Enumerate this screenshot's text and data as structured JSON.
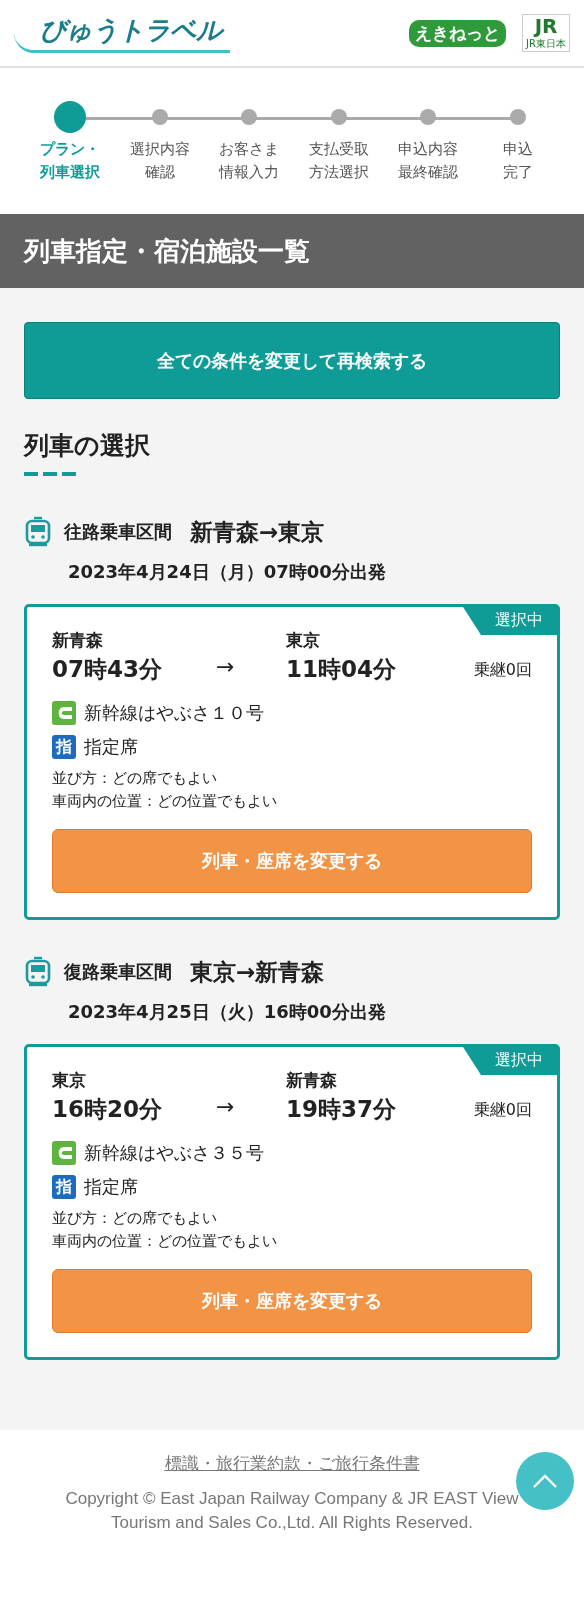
{
  "header": {
    "logo": "びゅうトラベル",
    "partner_logo": "えきねっと",
    "jr_logo": "JR",
    "jr_caption": "JR東日本"
  },
  "steps": [
    {
      "lines": [
        "プラン・",
        "列車選択"
      ],
      "selected": true
    },
    {
      "lines": [
        "選択内容",
        "確認"
      ],
      "selected": false
    },
    {
      "lines": [
        "お客さま",
        "情報入力"
      ],
      "selected": false
    },
    {
      "lines": [
        "支払受取",
        "方法選択"
      ],
      "selected": false
    },
    {
      "lines": [
        "申込内容",
        "最終確認"
      ],
      "selected": false
    },
    {
      "lines": [
        "申込",
        "完了"
      ],
      "selected": false
    }
  ],
  "page_title": "列車指定・宿泊施設一覧",
  "research_button": "全ての条件を変更して再検索する",
  "section_title": "列車の選択",
  "legs": [
    {
      "label": "往路乗車区間",
      "route": "新青森→東京",
      "departure": "2023年4月24日（月）07時00分出発",
      "badge": "選択中",
      "from": "新青森",
      "from_time": "07時43分",
      "arrow": "→",
      "to": "東京",
      "to_time": "11時04分",
      "transfers": "乗継0回",
      "train": "新幹線はやぶさ１０号",
      "seat_icon": "指",
      "seat": "指定席",
      "notes": [
        "並び方：どの席でもよい",
        "車両内の位置：どの位置でもよい"
      ],
      "button": "列車・座席を変更する"
    },
    {
      "label": "復路乗車区間",
      "route": "東京→新青森",
      "departure": "2023年4月25日（火）16時00分出発",
      "badge": "選択中",
      "from": "東京",
      "from_time": "16時20分",
      "arrow": "→",
      "to": "新青森",
      "to_time": "19時37分",
      "transfers": "乗継0回",
      "train": "新幹線はやぶさ３５号",
      "seat_icon": "指",
      "seat": "指定席",
      "notes": [
        "並び方：どの席でもよい",
        "車両内の位置：どの位置でもよい"
      ],
      "button": "列車・座席を変更する"
    }
  ],
  "footer": {
    "link": "標識・旅行業約款・ご旅行条件書",
    "copyright": "Copyright © East Japan Railway Company & JR EAST View Tourism and Sales Co.,Ltd. All Rights Reserved."
  }
}
